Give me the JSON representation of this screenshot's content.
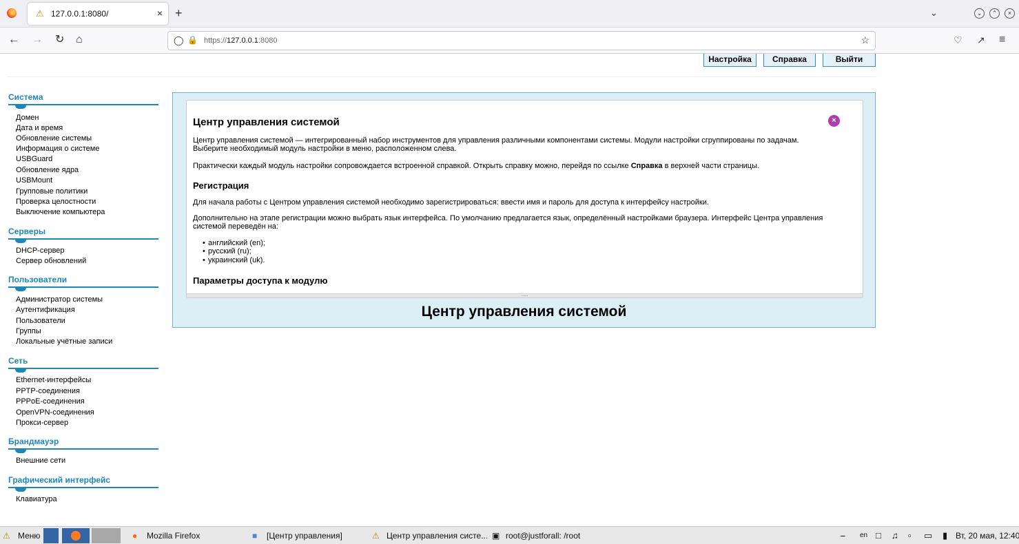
{
  "browser": {
    "tab_title": "127.0.0.1:8080/",
    "close_tab_glyph": "×",
    "new_tab_glyph": "+",
    "url_prefix": "https://",
    "url_host": "127.0.0.1",
    "url_port": ":8080"
  },
  "topnav": [
    {
      "label": "Настройка"
    },
    {
      "label": "Справка"
    },
    {
      "label": "Выйти"
    }
  ],
  "sidebar": [
    {
      "title": "Система",
      "items": [
        "Домен",
        "Дата и время",
        "Обновление системы",
        "Информация о системе",
        "USBGuard",
        "Обновление ядра",
        "USBMount",
        "Групповые политики",
        "Проверка целостности",
        "Выключение компьютера"
      ]
    },
    {
      "title": "Серверы",
      "items": [
        "DHCP-сервер",
        "Сервер обновлений"
      ]
    },
    {
      "title": "Пользователи",
      "items": [
        "Администратор системы",
        "Аутентификация",
        "Пользователи",
        "Группы",
        "Локальные учётные записи"
      ]
    },
    {
      "title": "Сеть",
      "items": [
        "Ethernet-интерфейсы",
        "PPTP-соединения",
        "PPPoE-соединения",
        "OpenVPN-соединения",
        "Прокси-сервер"
      ]
    },
    {
      "title": "Брандмауэр",
      "items": [
        "Внешние сети"
      ]
    },
    {
      "title": "Графический интерфейс",
      "items": [
        "Клавиатура"
      ]
    }
  ],
  "help": {
    "title": "Центр управления системой",
    "intro_1": "Центр управления системой — интегрированный набор инструментов для управления различными компонентами системы. Модули настройки сгруппированы по задачам.",
    "intro_2": "Выберите необходимый модуль настройки в меню, расположенном слева.",
    "help_pre": "Практически каждый модуль настройки сопровождается встроенной справкой. Открыть справку можно, перейдя по ссылке ",
    "help_bold": "Справка",
    "help_post": " в верхней части страницы.",
    "reg_title": "Регистрация",
    "reg_text": "Для начала работы с Центром управления системой необходимо зарегистрироваться: ввести имя и пароль для доступа к интерфейсу настройки.",
    "lang_text_1": "Дополнительно на этапе регистрации можно выбрать язык интерфейса. По умолчанию предлагается язык, определённый настройками браузера. Интерфейс Центра управления",
    "lang_text_2": "системой переведён на:",
    "languages": [
      "английский (en);",
      "русский (ru);",
      "украинский (uk)."
    ],
    "access_title": "Параметры доступа к модулю",
    "resize_grip": "....."
  },
  "panel_title": "Центр управления системой",
  "taskbar": {
    "menu_label": "Меню",
    "windows": [
      "Mozilla Firefox",
      "[Центр управления]",
      "Центр управления систе...",
      "root@justforall: /root"
    ],
    "lang": "en",
    "clock": "Вт, 20 мая, 12:40"
  }
}
